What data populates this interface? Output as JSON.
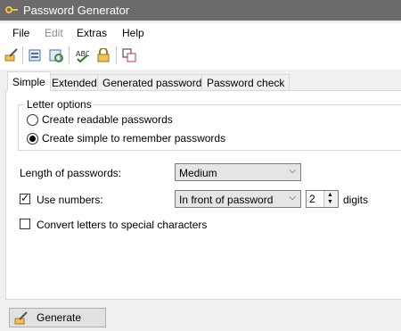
{
  "window": {
    "title": "Password Generator"
  },
  "menu": {
    "file": "File",
    "edit": "Edit",
    "extras": "Extras",
    "help": "Help"
  },
  "tabs": {
    "simple": "Simple",
    "extended": "Extended",
    "generated": "Generated passwords",
    "check": "Password check"
  },
  "letter_options": {
    "title": "Letter options",
    "readable": "Create readable passwords",
    "simple": "Create simple to remember passwords",
    "selected": "simple"
  },
  "length": {
    "label": "Length of passwords:",
    "value": "Medium"
  },
  "numbers": {
    "label": "Use numbers:",
    "checked": true,
    "position": "In front of password",
    "count": "2",
    "unit": "digits"
  },
  "special": {
    "label": "Convert letters to special characters",
    "checked": false
  },
  "generate": {
    "label": "Generate"
  }
}
